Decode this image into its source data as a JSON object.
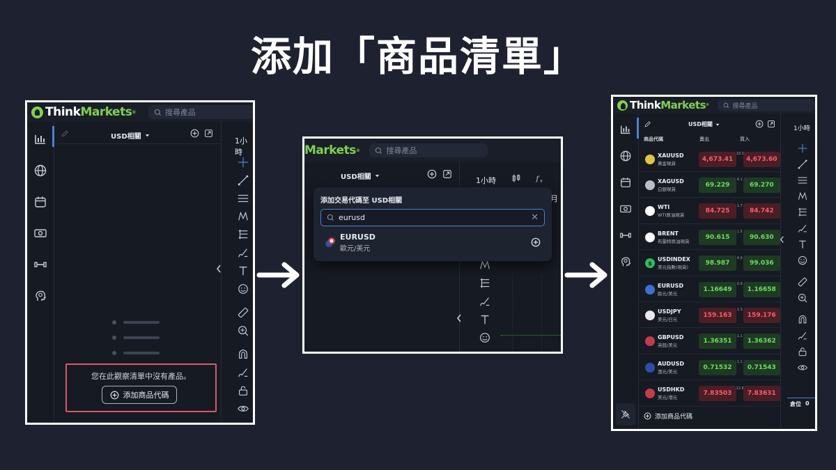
{
  "heading": "添加「商品清單」",
  "colors": {
    "brand_green": "#7fd24a",
    "up": "#67e05a",
    "down": "#ff5b6a",
    "highlight_box": "#e0566a",
    "accent_blue": "#4a82d6"
  },
  "icons": [
    "search-icon",
    "pencil-icon",
    "plus-circle-icon",
    "popout-icon",
    "watchlist-icon",
    "globe-icon",
    "calendar-icon",
    "cash-icon",
    "dumbbell-icon",
    "brain-icon",
    "crosshair-icon",
    "line-icon",
    "channel-icon",
    "pattern-icon",
    "fib-icon",
    "brush-icon",
    "text-icon",
    "emoji-icon",
    "ruler-icon",
    "zoom-icon",
    "magnet-icon",
    "lock-icon",
    "eye-icon",
    "chevron-left-icon",
    "arrow-right-icon"
  ],
  "app": {
    "logo_think": "Think",
    "logo_markets": "Markets",
    "logo_reg": "®",
    "search_placeholder": "搜尋產品"
  },
  "step1": {
    "watchlist_title": "USD相關",
    "timeframe": "1小時",
    "empty_message": "您在此觀察清單中沒有產品。",
    "add_button": "添加商品代碼"
  },
  "step2": {
    "logo_markets": "Markets",
    "search_placeholder": "搜尋產品",
    "watchlist_title": "USD相關",
    "timeframe": "1小時",
    "month_fragment": "月",
    "popup_title": "添加交易代碼至 USD相關",
    "query": "eurusd",
    "result_symbol": "EURUSD",
    "result_name": "歐元/美元"
  },
  "step3": {
    "watchlist_title": "USD相關",
    "col_symbol": "商品代碼",
    "col_sell": "賣出",
    "col_buy": "買入",
    "timeframe": "1小時",
    "positions_label": "倉位",
    "positions_count": "0",
    "add_button": "添加商品代碼",
    "rows": [
      {
        "symbol": "XAUUSD",
        "name": "黃金現貨",
        "sell": "4,673.41",
        "spread": "19.0",
        "buy": "4,673.60",
        "sell_dir": "down",
        "buy_dir": "down",
        "badge_color": "#e4c53a",
        "badge_text": ""
      },
      {
        "symbol": "XAGUSD",
        "name": "白銀現貨",
        "sell": "69.229",
        "spread": "4.1",
        "buy": "69.270",
        "sell_dir": "up",
        "buy_dir": "up",
        "badge_color": "#b9bec8",
        "badge_text": ""
      },
      {
        "symbol": "WTI",
        "name": "WTI原油現貨",
        "sell": "84.725",
        "spread": "1.7",
        "buy": "84.742",
        "sell_dir": "down",
        "buy_dir": "down",
        "badge_color": "#ffffff",
        "badge_text": ""
      },
      {
        "symbol": "BRENT",
        "name": "布蘭特原油現貨",
        "sell": "90.615",
        "spread": "1.5",
        "buy": "90.630",
        "sell_dir": "up",
        "buy_dir": "up",
        "badge_color": "#ffffff",
        "badge_text": ""
      },
      {
        "symbol": "USDINDEX",
        "name": "美元指數(現貨)",
        "sell": "98.987",
        "spread": "4.9",
        "buy": "99.036",
        "sell_dir": "up",
        "buy_dir": "up",
        "badge_color": "#2bbf5a",
        "badge_text": "$"
      },
      {
        "symbol": "EURUSD",
        "name": "歐元/美元",
        "sell": "1.16649",
        "spread": "0.9",
        "buy": "1.16658",
        "sell_dir": "up",
        "buy_dir": "up",
        "badge_color": "#3d6fd1",
        "badge_text": ""
      },
      {
        "symbol": "USDJPY",
        "name": "美元/日元",
        "sell": "159.163",
        "spread": "1.3",
        "buy": "159.176",
        "sell_dir": "down",
        "buy_dir": "down",
        "badge_color": "#e8e8ee",
        "badge_text": ""
      },
      {
        "symbol": "GBPUSD",
        "name": "英鎊/美元",
        "sell": "1.36351",
        "spread": "1.1",
        "buy": "1.36362",
        "sell_dir": "up",
        "buy_dir": "up",
        "badge_color": "#c73a4a",
        "badge_text": ""
      },
      {
        "symbol": "AUDUSD",
        "name": "澳元/美元",
        "sell": "0.71532",
        "spread": "1.1",
        "buy": "0.71543",
        "sell_dir": "up",
        "buy_dir": "up",
        "badge_color": "#2d4fa8",
        "badge_text": ""
      },
      {
        "symbol": "USDHKD",
        "name": "美元/港元",
        "sell": "7.83503",
        "spread": "12.8",
        "buy": "7.83631",
        "sell_dir": "down",
        "buy_dir": "down",
        "badge_color": "#c73a4a",
        "badge_text": ""
      }
    ]
  }
}
